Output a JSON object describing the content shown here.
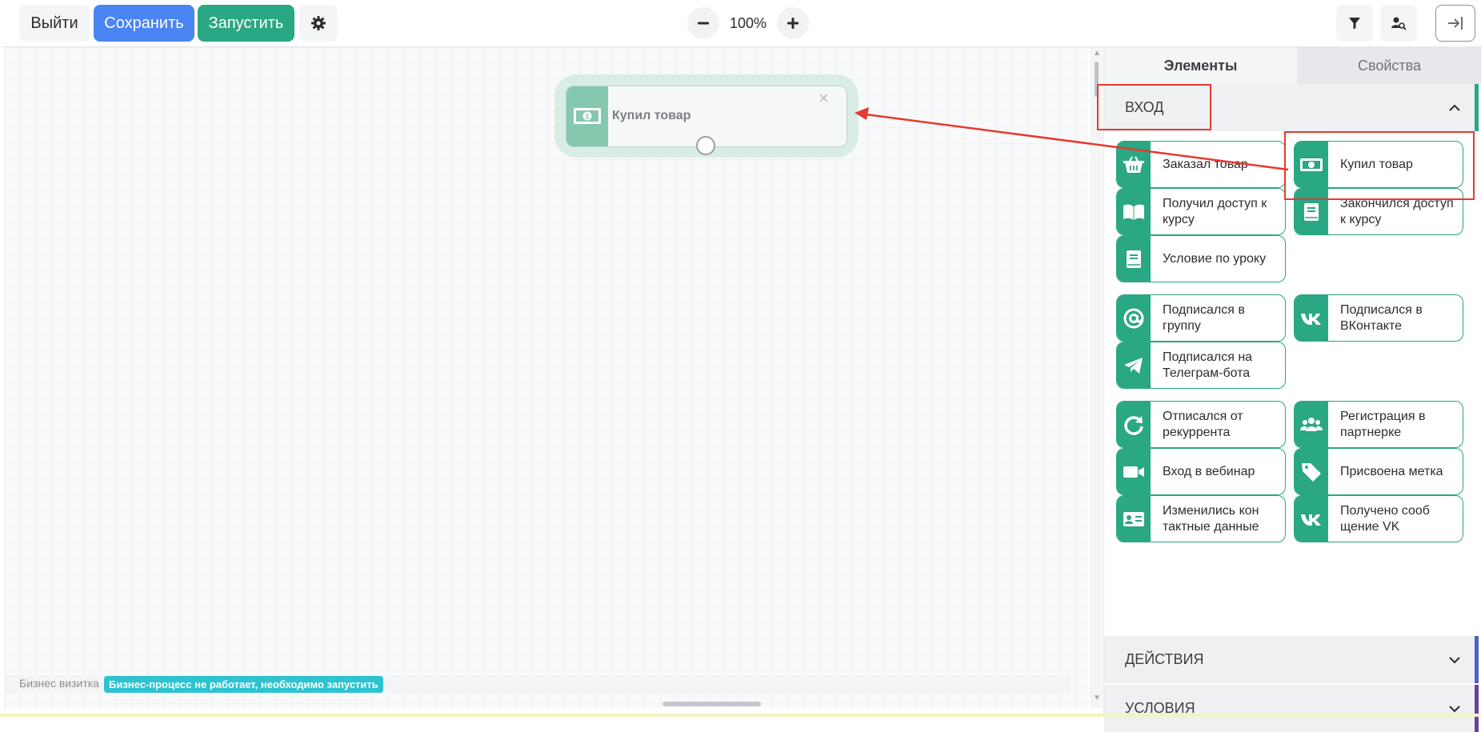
{
  "toolbar": {
    "exit_label": "Выйти",
    "save_label": "Сохранить",
    "run_label": "Запустить",
    "zoom_value": "100%"
  },
  "canvas": {
    "node": {
      "label": "Купил товар",
      "close_glyph": "×"
    },
    "status": {
      "process_name": "Бизнес визитка",
      "badge": "Бизнес-процесс не работает, необходимо запустить"
    }
  },
  "sidebar": {
    "tabs": [
      "Элементы",
      "Свойства"
    ],
    "sections": [
      {
        "title": "ВХОД",
        "expanded": true,
        "color": "#2aa783"
      },
      {
        "title": "ДЕЙСТВИЯ",
        "expanded": false,
        "color": "#4b62c8"
      },
      {
        "title": "УСЛОВИЯ",
        "expanded": false,
        "color": "#6a3fa0"
      }
    ],
    "cards": [
      {
        "label": "Заказал товар",
        "icon": "basket-icon"
      },
      {
        "label": "Купил товар",
        "icon": "money-icon"
      },
      {
        "label": "Получил доступ к курсу",
        "icon": "book-open-icon"
      },
      {
        "label": "Закончился доступ к курсу",
        "icon": "book-icon"
      },
      {
        "label": "Условие по уроку",
        "icon": "book-icon"
      },
      {
        "label": "Подписался в группу",
        "icon": "at-icon"
      },
      {
        "label": "Подписался в ВКонтакте",
        "icon": "vk-icon"
      },
      {
        "label": "Подписался на Телеграм-бота",
        "icon": "telegram-icon"
      },
      {
        "label": "Отписался от рекуррента",
        "icon": "refresh-icon"
      },
      {
        "label": "Регистрация в партнерке",
        "icon": "users-icon"
      },
      {
        "label": "Вход в вебинар",
        "icon": "video-icon"
      },
      {
        "label": "Присвоена метка",
        "icon": "tag-icon"
      },
      {
        "label": "Изменились кон тактные данные",
        "icon": "contact-card-icon"
      },
      {
        "label": "Получено сооб щение VK",
        "icon": "vk-icon"
      }
    ]
  },
  "colors": {
    "accent": "#2aa783",
    "primary": "#4b84f3",
    "annotation": "#e53a2f"
  }
}
